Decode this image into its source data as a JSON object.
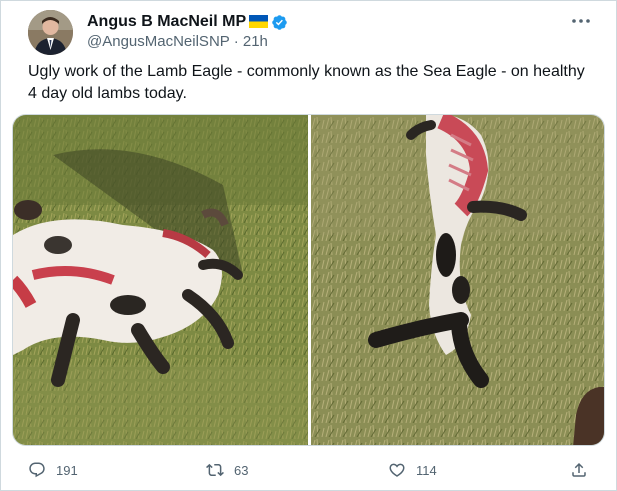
{
  "tweet": {
    "author_name": "Angus B MacNeil MP",
    "handle": "@AngusMacNeilSNP",
    "separator": "·",
    "time": "21h",
    "text": "Ugly work of the Lamb Eagle - commonly known as the Sea Eagle - on healthy 4 day old lambs today.",
    "images": [
      {
        "icon": "photo-lamb-left"
      },
      {
        "icon": "photo-lamb-right"
      }
    ]
  },
  "actions": {
    "reply_count": "191",
    "retweet_count": "63",
    "like_count": "114"
  },
  "icons": {
    "verified": "verified-badge-icon",
    "flag": "ukraine-flag-icon",
    "more": "more-options-icon",
    "reply": "reply-icon",
    "retweet": "retweet-icon",
    "like": "heart-icon",
    "share": "share-icon"
  },
  "colors": {
    "verified_blue": "#1d9bf0",
    "flag_blue": "#0057b7",
    "flag_yellow": "#ffd700",
    "secondary_text": "#536471",
    "primary_text": "#0f1419"
  }
}
